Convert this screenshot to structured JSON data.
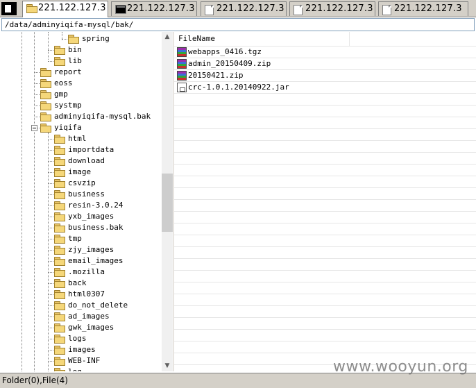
{
  "tabs": [
    {
      "label": "221.122.127.3",
      "icon": "folder-icon",
      "active": true
    },
    {
      "label": "221.122.127.3",
      "icon": "terminal-icon",
      "active": false
    },
    {
      "label": "221.122.127.3",
      "icon": "document-icon",
      "active": false
    },
    {
      "label": "221.122.127.3",
      "icon": "document-icon",
      "active": false
    },
    {
      "label": "221.122.127.3",
      "icon": "document-icon",
      "active": false
    }
  ],
  "path": "/data/adminyiqifa-mysql/bak/",
  "tree": {
    "items": [
      "spring",
      "bin",
      "lib",
      "report",
      "eoss",
      "gmp",
      "systmp",
      "adminyiqifa-mysql.bak",
      "yiqifa",
      "html",
      "importdata",
      "download",
      "image",
      "csvzip",
      "business",
      "resin-3.0.24",
      "yxb_images",
      "business.bak",
      "tmp",
      "zjy_images",
      "email_images",
      ".mozilla",
      "back",
      "html0307",
      "do_not_delete",
      "ad_images",
      "gwk_images",
      "logs",
      "images",
      "WEB-INF",
      "log"
    ]
  },
  "filelist": {
    "header": "FileName",
    "files": [
      {
        "name": "webapps_0416.tgz",
        "icon": "archive-icon"
      },
      {
        "name": "admin_20150409.zip",
        "icon": "archive-icon"
      },
      {
        "name": "20150421.zip",
        "icon": "archive-icon"
      },
      {
        "name": "crc-1.0.1.20140922.jar",
        "icon": "jar-file-icon"
      }
    ]
  },
  "status": "Folder(0),File(4)",
  "watermark": "www.wooyun.org",
  "colors": {
    "chrome": "#d4d0c8",
    "folder": "#f5d77a",
    "gridline": "#e6e6e6"
  }
}
